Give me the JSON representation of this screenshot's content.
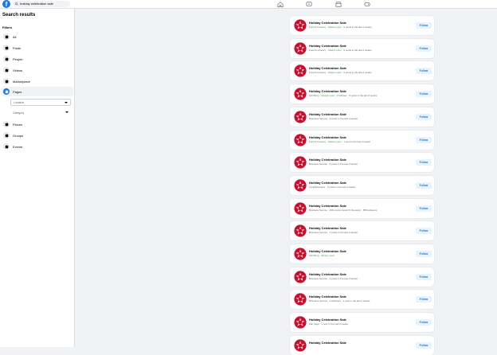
{
  "topbar": {
    "logo_letter": "f",
    "search_value": "holiday celebration sale"
  },
  "sidebar": {
    "title": "Search results",
    "filters_heading": "Filters",
    "items": [
      {
        "label": "All",
        "icon": "grid-icon",
        "active": false
      },
      {
        "label": "Posts",
        "icon": "posts-icon",
        "active": false
      },
      {
        "label": "People",
        "icon": "people-icon",
        "active": false
      },
      {
        "label": "Videos",
        "icon": "video-icon",
        "active": false
      },
      {
        "label": "Marketplace",
        "icon": "marketplace-icon",
        "active": false
      },
      {
        "label": "Pages",
        "icon": "flag-icon",
        "active": true
      },
      {
        "label": "Places",
        "icon": "pin-icon",
        "active": false
      },
      {
        "label": "Groups",
        "icon": "groups-icon",
        "active": false
      },
      {
        "label": "Events",
        "icon": "calendar-icon",
        "active": false
      }
    ],
    "location_label": "Location",
    "category_label": "Category"
  },
  "results": [
    {
      "name": "Holiday Celebration Sale",
      "meta_pre": "Food & Grocery · ",
      "meta_open": "Always open",
      "meta_post": " · 6 posts in the last 2 weeks",
      "follow": "Follow"
    },
    {
      "name": "Holiday Celebration Sale",
      "meta_pre": "Food & Grocery · ",
      "meta_open": "Always open",
      "meta_post": " · 6 posts in the last 2 weeks",
      "follow": "Follow"
    },
    {
      "name": "Holiday Celebration Sale",
      "meta_pre": "Food & Grocery · ",
      "meta_open": "Always open",
      "meta_post": " · 6 posts in the last 2 weeks",
      "follow": "Follow"
    },
    {
      "name": "Holiday Celebration Sale",
      "meta_pre": "Gift Shop · ",
      "meta_open": "Always open",
      "meta_post": " · 1 follower · 6 posts in the last 2 weeks",
      "follow": "Follow"
    },
    {
      "name": "Holiday Celebration Sale",
      "meta_pre": "Business Service · 5 posts in the last 2 weeks",
      "meta_open": "",
      "meta_post": "",
      "follow": "Follow"
    },
    {
      "name": "Holiday Celebration Sale",
      "meta_pre": "Food & Grocery · ",
      "meta_open": "Always open",
      "meta_post": " · 1 post in the last 2 weeks",
      "follow": "Follow"
    },
    {
      "name": "Holiday Celebration Sale",
      "meta_pre": "Business Service · 5 posts in the last 2 weeks",
      "meta_open": "",
      "meta_post": "",
      "follow": "Follow"
    },
    {
      "name": "Holiday Celebration Sale",
      "meta_pre": "Local Business · 5 posts in the last 2 weeks",
      "meta_open": "",
      "meta_post": "",
      "follow": "Follow"
    },
    {
      "name": "Holiday Celebration Sale",
      "meta_pre": "Business Service · 20% recommend (6 Reviews) · 565 followers",
      "meta_open": "",
      "meta_post": "",
      "follow": "Follow"
    },
    {
      "name": "Holiday Celebration Sale",
      "meta_pre": "Business Service · 4 posts in the last 2 weeks",
      "meta_open": "",
      "meta_post": "",
      "follow": "Follow"
    },
    {
      "name": "Holiday Celebration Sale",
      "meta_pre": "Gift Shop · ",
      "meta_open": "Always open",
      "meta_post": "",
      "follow": "Follow"
    },
    {
      "name": "Holiday Celebration Sale",
      "meta_pre": "Business Service · 4 posts in the last 2 weeks",
      "meta_open": "",
      "meta_post": "",
      "follow": "Follow"
    },
    {
      "name": "Holiday Celebration Sale",
      "meta_pre": "Business Service · 2 followers · 1 post in the last 2 weeks",
      "meta_open": "",
      "meta_post": "",
      "follow": "Follow"
    },
    {
      "name": "Holiday Celebration Sale",
      "meta_pre": "Fan page · 1 post in the last 2 weeks",
      "meta_open": "",
      "meta_post": "",
      "follow": "Follow"
    },
    {
      "name": "Holiday Celebration Sale",
      "meta_pre": "",
      "meta_open": "",
      "meta_post": "",
      "follow": "Follow"
    }
  ],
  "colors": {
    "brand": "#1877f2",
    "open": "#31a24c",
    "avatar": "#c8102e"
  }
}
